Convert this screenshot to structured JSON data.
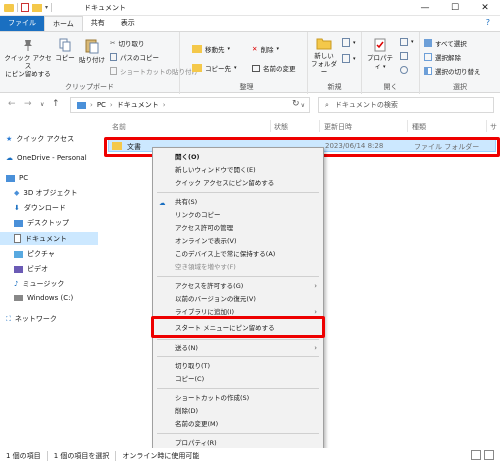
{
  "window": {
    "title": "ドキュメント",
    "minimize": "—",
    "maximize": "☐",
    "close": "✕"
  },
  "tabs": [
    {
      "label": "ファイル"
    },
    {
      "label": "ホーム"
    },
    {
      "label": "共有"
    },
    {
      "label": "表示"
    }
  ],
  "help": "?",
  "ribbon": {
    "clipboard": {
      "label": "クリップボード",
      "pin": "クイック アクセス\nにピン留めする",
      "copy": "コピー",
      "paste": "貼り付け",
      "cut": "切り取り",
      "copy_path": "パスのコピー",
      "paste_shortcut": "ショートカットの貼り付け"
    },
    "organize": {
      "label": "整理",
      "move_to": "移動先",
      "delete": "削除",
      "copy_to": "コピー先",
      "rename": "名前の変更"
    },
    "new": {
      "label": "新規",
      "new_folder": "新しい\nフォルダー"
    },
    "open": {
      "label": "開く",
      "properties": "プロパティ"
    },
    "select": {
      "label": "選択",
      "select_all": "すべて選択",
      "select_none": "選択解除",
      "invert": "選択の切り替え"
    }
  },
  "address": {
    "path": [
      "PC",
      "ドキュメント"
    ],
    "search_placeholder": "ドキュメントの検索"
  },
  "nav_pane": [
    {
      "label": "クイック アクセス",
      "icon": "star-icon"
    },
    {
      "label": "OneDrive - Personal",
      "icon": "cloud-icon"
    },
    {
      "label": "PC",
      "icon": "pc-icon"
    },
    {
      "label": "3D オブジェクト",
      "icon": "cube-icon"
    },
    {
      "label": "ダウンロード",
      "icon": "download-icon"
    },
    {
      "label": "デスクトップ",
      "icon": "desktop-icon"
    },
    {
      "label": "ドキュメント",
      "icon": "document-icon"
    },
    {
      "label": "ピクチャ",
      "icon": "picture-icon"
    },
    {
      "label": "ビデオ",
      "icon": "video-icon"
    },
    {
      "label": "ミュージック",
      "icon": "music-icon"
    },
    {
      "label": "Windows (C:)",
      "icon": "drive-icon"
    },
    {
      "label": "ネットワーク",
      "icon": "network-icon"
    }
  ],
  "columns": {
    "name": "名前",
    "status": "状態",
    "date": "更新日時",
    "type": "種類",
    "size": "サ"
  },
  "file": {
    "name": "文書",
    "date": "2023/06/14 8:28",
    "type": "ファイル フォルダー"
  },
  "context_menu": [
    {
      "label": "開く(O)"
    },
    {
      "label": "新しいウィンドウで開く(E)"
    },
    {
      "label": "クイック アクセスにピン留めする"
    },
    {
      "label": "共有(S)"
    },
    {
      "label": "リンクのコピー"
    },
    {
      "label": "アクセス許可の管理"
    },
    {
      "label": "オンラインで表示(V)"
    },
    {
      "label": "このデバイス上で常に保持する(A)"
    },
    {
      "label": "空き領域を増やす(F)"
    },
    {
      "label": "アクセスを許可する(G)"
    },
    {
      "label": "以前のバージョンの復元(V)"
    },
    {
      "label": "ライブラリに追加(I)"
    },
    {
      "label": "スタート メニューにピン留めする"
    },
    {
      "label": "送る(N)"
    },
    {
      "label": "切り取り(T)"
    },
    {
      "label": "コピー(C)"
    },
    {
      "label": "ショートカットの作成(S)"
    },
    {
      "label": "削除(D)"
    },
    {
      "label": "名前の変更(M)"
    },
    {
      "label": "プロパティ(R)"
    }
  ],
  "statusbar": {
    "items_count": "1 個の項目",
    "selected": "1 個の項目を選択",
    "availability": "オンライン時に使用可能"
  },
  "colors": {
    "accent": "#1a6fc1",
    "highlight": "#e00000",
    "selection": "#cce8ff"
  }
}
